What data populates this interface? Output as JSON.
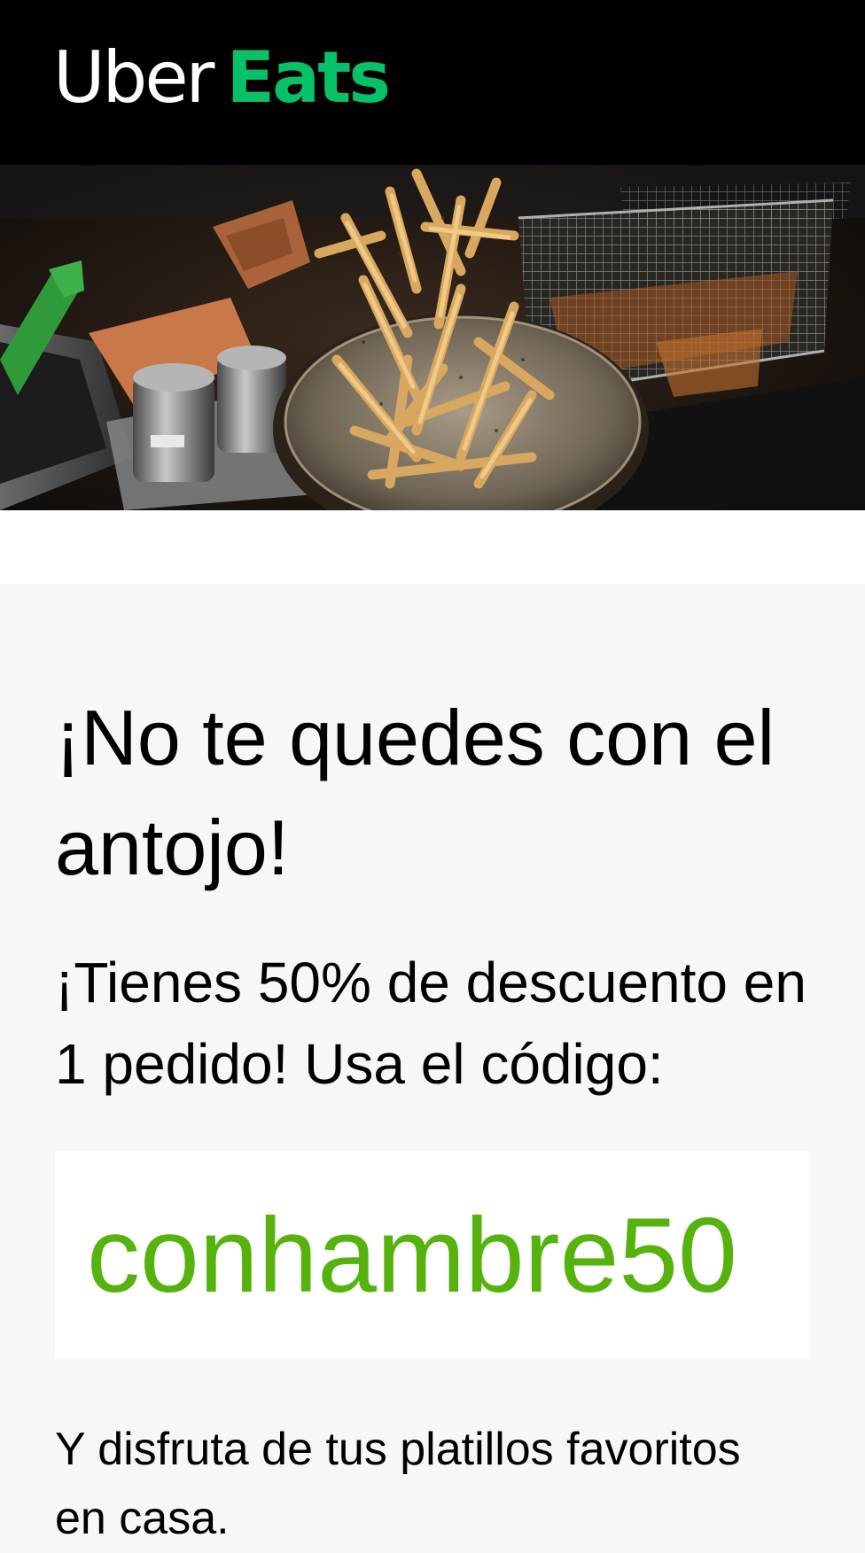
{
  "brand": {
    "name_part1": "Uber",
    "name_part2": "Eats",
    "primary_color": "#000000",
    "accent_color": "#06c167"
  },
  "hero": {
    "image_subject": "fries-tossed-in-pan-kitchen-photo"
  },
  "promo": {
    "headline": "¡No te quedes con el antojo!",
    "subtext": "¡Tienes 50% de descuento en 1 pedido! Usa el código:",
    "code": "conhambre50",
    "code_color": "#56b30e",
    "footer": "Y disfruta de tus platillos favoritos en casa."
  }
}
